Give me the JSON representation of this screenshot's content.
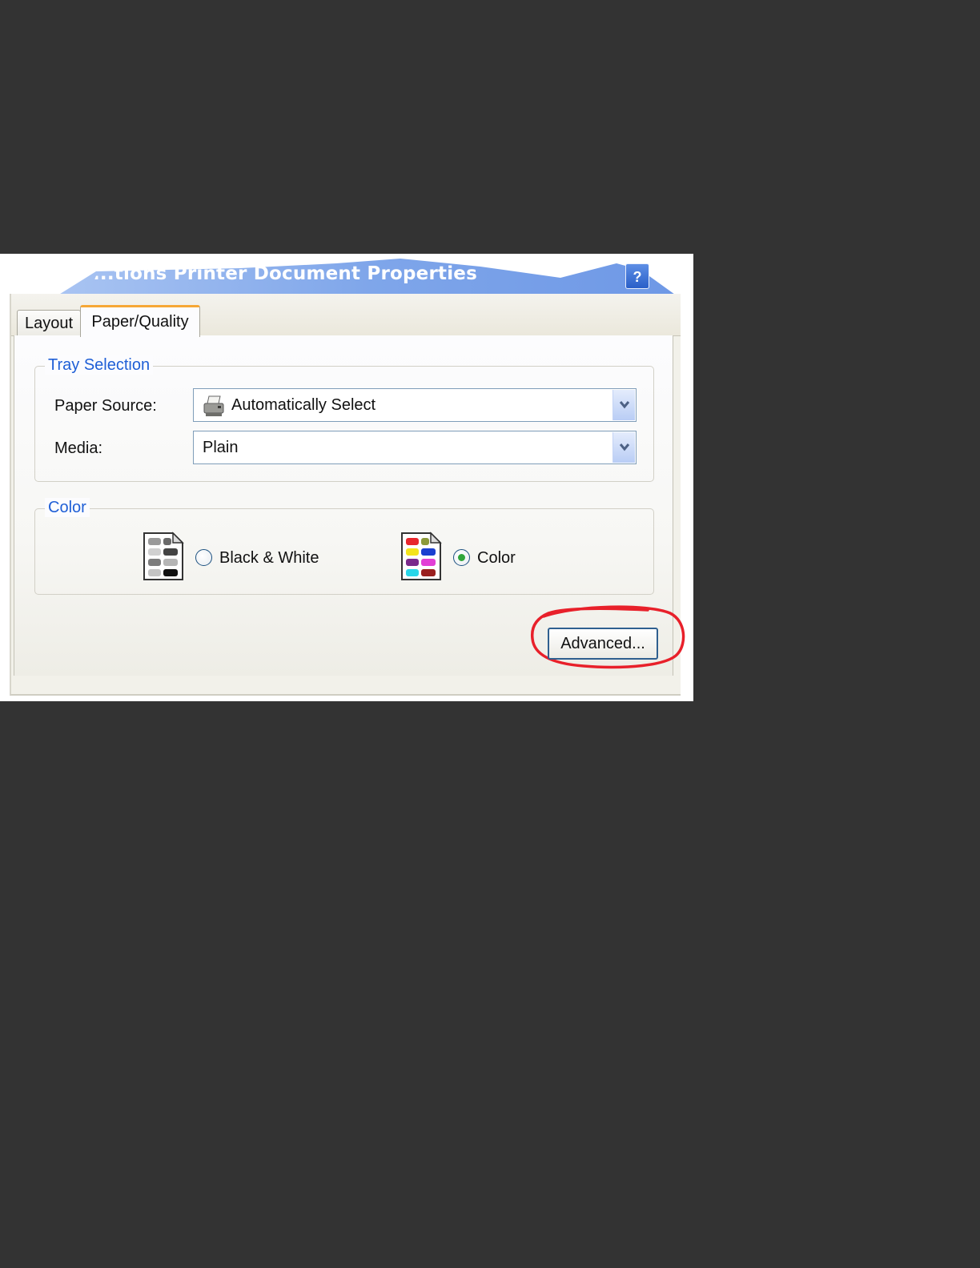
{
  "window": {
    "title": "...tions Printer Document Properties",
    "help_label": "?"
  },
  "tabs": [
    {
      "label": "Layout",
      "selected": false
    },
    {
      "label": "Paper/Quality",
      "selected": true
    }
  ],
  "tray_selection": {
    "legend": "Tray Selection",
    "paper_source": {
      "label": "Paper Source:",
      "value": "Automatically Select"
    },
    "media": {
      "label": "Media:",
      "value": "Plain"
    }
  },
  "color_group": {
    "legend": "Color",
    "options": [
      {
        "label": "Black & White",
        "selected": false
      },
      {
        "label": "Color",
        "selected": true
      }
    ]
  },
  "buttons": {
    "advanced": "Advanced..."
  },
  "colors": {
    "accent": "#1f5fd6",
    "title_bar": "#7fa6ea",
    "annotation": "#e8202a",
    "tab_highlight": "#f6a735"
  }
}
